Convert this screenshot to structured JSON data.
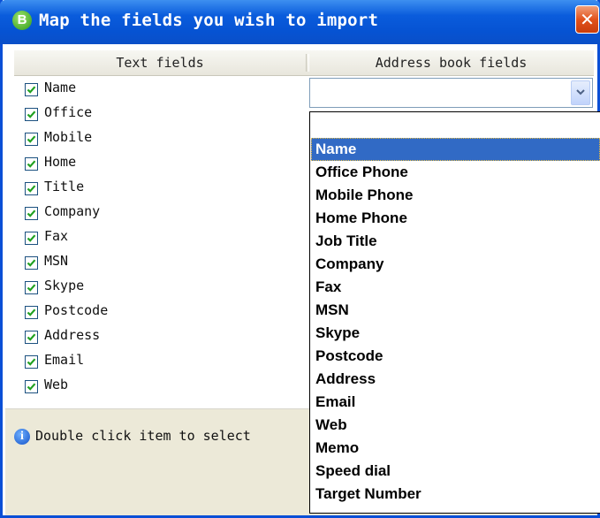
{
  "window": {
    "title": "Map the fields you wish to import",
    "app_icon_letter": "B",
    "close_glyph": "✕"
  },
  "columns": {
    "left": "Text fields",
    "right": "Address book fields"
  },
  "fields": [
    {
      "label": "Name",
      "checked": true
    },
    {
      "label": "Office",
      "checked": true
    },
    {
      "label": "Mobile",
      "checked": true
    },
    {
      "label": "Home",
      "checked": true
    },
    {
      "label": "Title",
      "checked": true
    },
    {
      "label": "Company",
      "checked": true
    },
    {
      "label": "Fax",
      "checked": true
    },
    {
      "label": "MSN",
      "checked": true
    },
    {
      "label": "Skype",
      "checked": true
    },
    {
      "label": "Postcode",
      "checked": true
    },
    {
      "label": "Address",
      "checked": true
    },
    {
      "label": "Email",
      "checked": true
    },
    {
      "label": "Web",
      "checked": true
    }
  ],
  "combo": {
    "value": ""
  },
  "dropdown": {
    "options": [
      "",
      "Name",
      "Office Phone",
      "Mobile Phone",
      "Home Phone",
      "Job Title",
      "Company",
      "Fax",
      "MSN",
      "Skype",
      "Postcode",
      "Address",
      "Email",
      "Web",
      "Memo",
      "Speed dial",
      "Target Number"
    ],
    "selected": "Name"
  },
  "status": {
    "text": "Double click item to select"
  },
  "colors": {
    "titlebar": "#0a5cdc",
    "selection": "#316ac5",
    "checkmark": "#21a121"
  }
}
